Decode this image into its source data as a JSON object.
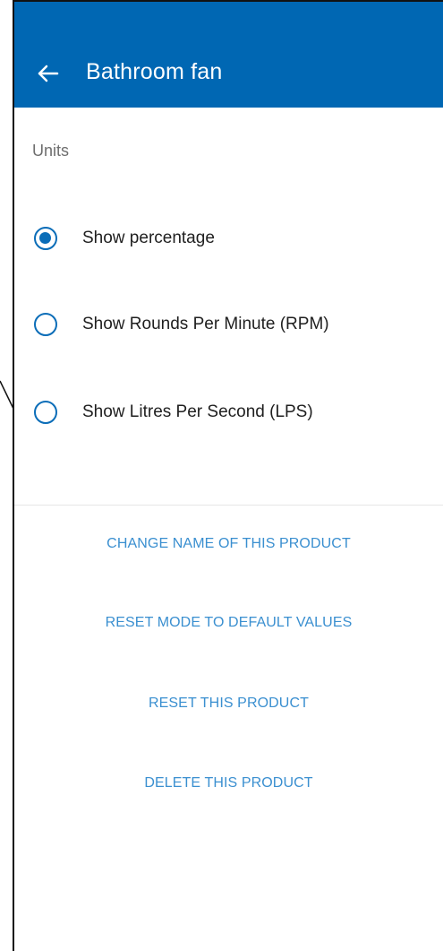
{
  "header": {
    "title": "Bathroom fan",
    "back_icon": "arrow-back-icon"
  },
  "units": {
    "section_label": "Units",
    "selected": "percentage",
    "options": [
      {
        "id": "percentage",
        "label": "Show percentage",
        "checked": true
      },
      {
        "id": "rpm",
        "label": "Show Rounds Per Minute (RPM)",
        "checked": false
      },
      {
        "id": "lps",
        "label": "Show Litres Per Second (LPS)",
        "checked": false
      }
    ]
  },
  "actions": [
    {
      "label": "CHANGE NAME OF THIS PRODUCT"
    },
    {
      "label": "RESET MODE TO DEFAULT VALUES"
    },
    {
      "label": "RESET THIS PRODUCT"
    },
    {
      "label": "DELETE THIS PRODUCT"
    }
  ],
  "colors": {
    "app_bar": "#0067b3",
    "radio_accent": "#0b6db8",
    "action_link": "#3a8fd0"
  }
}
